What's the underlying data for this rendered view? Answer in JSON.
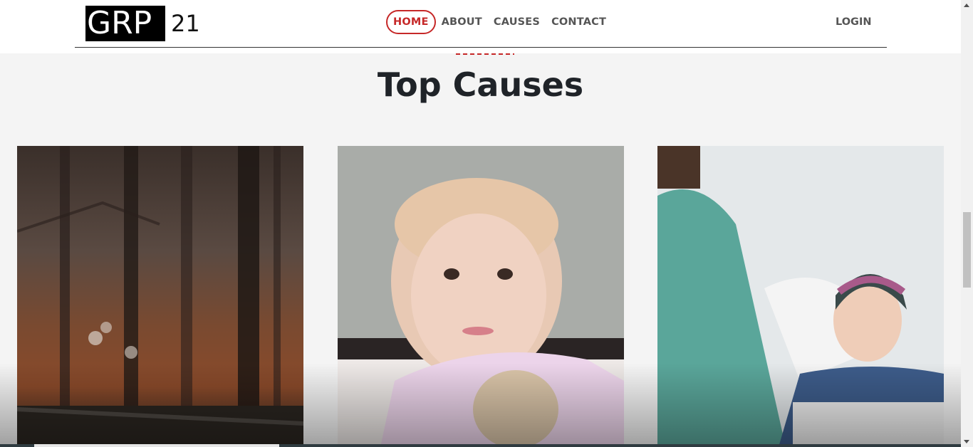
{
  "brand": {
    "logo_text": "GRP",
    "logo_number": "21"
  },
  "nav": {
    "items": [
      {
        "label": "HOME",
        "active": true
      },
      {
        "label": "ABOUT",
        "active": false
      },
      {
        "label": "CAUSES",
        "active": false
      },
      {
        "label": "CONTACT",
        "active": false
      }
    ],
    "login_label": "LOGIN"
  },
  "section": {
    "title": "Top Causes"
  },
  "cards": [
    {
      "image": "autumn-forest-image"
    },
    {
      "image": "child-patient-image"
    },
    {
      "image": "patient-and-nurse-image"
    }
  ],
  "colors": {
    "accent": "#c62828",
    "heading": "#1f2328",
    "nav_text": "#555555",
    "background": "#f4f4f4"
  }
}
